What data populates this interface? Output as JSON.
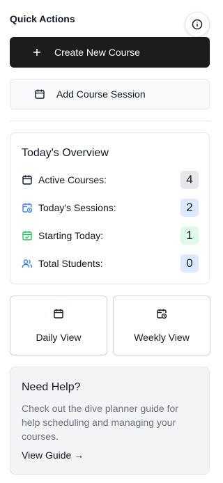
{
  "quick_actions": {
    "title": "Quick Actions",
    "info_icon": "info-icon",
    "create_course_label": "Create New Course",
    "add_session_label": "Add Course Session"
  },
  "overview": {
    "title": "Today's Overview",
    "stats": [
      {
        "label": "Active Courses:",
        "value": "4",
        "icon": "calendar-icon",
        "badge_color": "#e5e7eb"
      },
      {
        "label": "Today's Sessions:",
        "value": "2",
        "icon": "calendar-clock-icon",
        "badge_color": "#dbeafe",
        "icon_color": "#3b82f6"
      },
      {
        "label": "Starting Today:",
        "value": "1",
        "icon": "calendar-check-icon",
        "badge_color": "#dcfce7",
        "icon_color": "#22c55e"
      },
      {
        "label": "Total Students:",
        "value": "0",
        "icon": "users-icon",
        "badge_color": "#dbeafe",
        "icon_color": "#3b82f6"
      }
    ]
  },
  "views": {
    "daily_label": "Daily View",
    "weekly_label": "Weekly View"
  },
  "help": {
    "title": "Need Help?",
    "text": "Check out the dive planner guide for help scheduling and managing your courses.",
    "link_label": "View Guide →"
  }
}
